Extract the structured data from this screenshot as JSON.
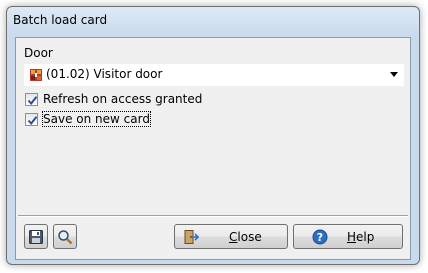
{
  "window": {
    "title": "Batch load card"
  },
  "door": {
    "label": "Door",
    "selected": "(01.02) Visitor door"
  },
  "options": {
    "refresh_label": "Refresh on access granted",
    "refresh_checked": true,
    "save_label": "Save on new card",
    "save_checked": true
  },
  "buttons": {
    "save_icon": "floppy-disk-icon",
    "preview_icon": "magnifier-icon",
    "close_label": "Close",
    "close_icon": "exit-door-icon",
    "help_label": "Help",
    "help_icon": "help-icon"
  },
  "colors": {
    "title_bar": "#c9daec",
    "client_bg": "#f0f0f0",
    "check_blue": "#2b4f9e"
  }
}
